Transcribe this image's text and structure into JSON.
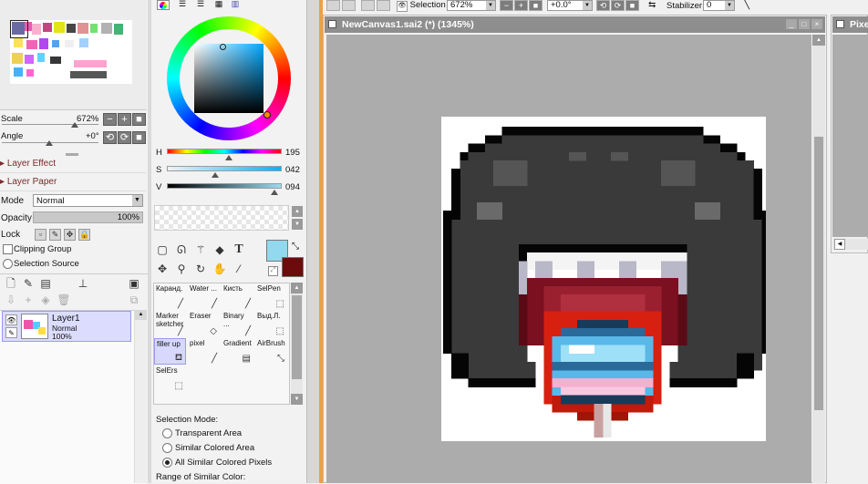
{
  "navigator": {
    "scale_label": "Scale",
    "scale_value": "672%",
    "angle_label": "Angle",
    "angle_value": "+0°"
  },
  "layer_panel": {
    "layer_effect": "Layer Effect",
    "layer_paper": "Layer Paper",
    "mode_label": "Mode",
    "mode_value": "Normal",
    "opacity_label": "Opacity",
    "opacity_value": "100%",
    "opacity_fraction": 1.0,
    "lock_label": "Lock",
    "clipping_group": "Clipping Group",
    "selection_source": "Selection Source",
    "layers": [
      {
        "name": "Layer1",
        "mode": "Normal",
        "opacity": "100%"
      }
    ]
  },
  "color": {
    "h_label": "H",
    "h_value": "195",
    "s_label": "S",
    "s_value": "042",
    "v_label": "V",
    "v_value": "094",
    "h_fraction": 0.54,
    "s_fraction": 0.42,
    "v_fraction": 0.94,
    "primary": "#92d8ee",
    "secondary": "#6b0b0b"
  },
  "brushes": [
    {
      "label": "Каранд.",
      "icon": "pencil-icon"
    },
    {
      "label": "Water ...",
      "icon": "water-brush-icon"
    },
    {
      "label": "Кисть",
      "icon": "brush-icon"
    },
    {
      "label": "SelPen",
      "icon": "selpen-icon"
    },
    {
      "label": "Marker sketcher",
      "icon": "marker-icon"
    },
    {
      "label": "Eraser",
      "icon": "eraser-icon"
    },
    {
      "label": "Binary ...",
      "icon": "binary-pen-icon"
    },
    {
      "label": "Выд.Л.",
      "icon": "select-pen-icon"
    },
    {
      "label": "filler up",
      "icon": "bucket-icon"
    },
    {
      "label": "pixel",
      "icon": "pixel-pen-icon"
    },
    {
      "label": "Gradient",
      "icon": "gradient-icon"
    },
    {
      "label": "AirBrush",
      "icon": "airbrush-icon"
    },
    {
      "label": "SelErs",
      "icon": "selection-eraser-icon"
    }
  ],
  "selection_options": {
    "mode_label": "Selection Mode:",
    "options": [
      "Transparent Area",
      "Similar Colored Area",
      "All Similar Colored Pixels"
    ],
    "selected_index": 2,
    "range_label": "Range of Similar Color:"
  },
  "toolbar": {
    "selection_label": "Selection",
    "zoom_value": "672%",
    "rotation_value": "+0.0°",
    "stabilizer_label": "Stabilizer",
    "stabilizer_value": "0"
  },
  "canvas": {
    "title": "NewCanvas1.sai2 (*) (1345%)",
    "bg_color": "#acacac"
  },
  "second_window": {
    "title": "Pixe"
  }
}
